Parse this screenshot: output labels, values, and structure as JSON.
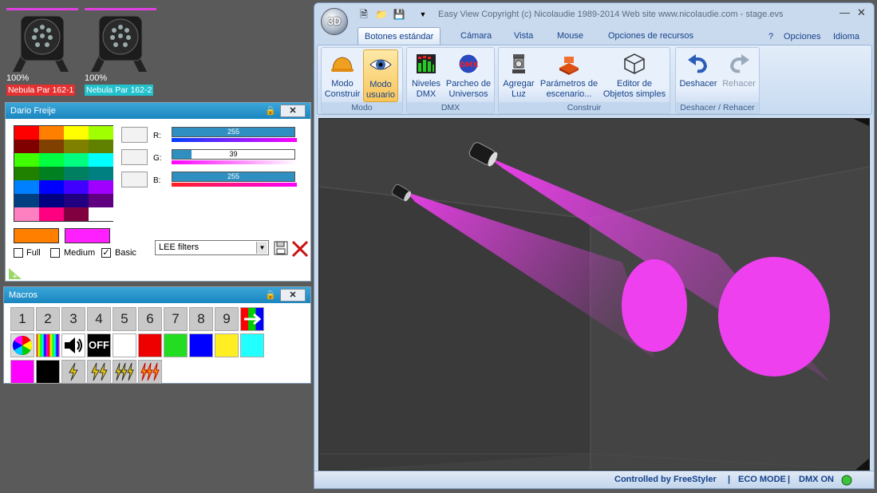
{
  "fixtures": [
    {
      "percent": "100%",
      "name": "Nebula Par 162-1",
      "label_color": "#e53030"
    },
    {
      "percent": "100%",
      "name": "Nebula Par 162-2",
      "label_color": "#22c2cc"
    }
  ],
  "color_panel": {
    "title": "Dario Freije",
    "swatches": [
      "#ff0000",
      "#ff8000",
      "#ffff00",
      "#a0ff00",
      "#800000",
      "#804000",
      "#808000",
      "#608000",
      "#40ff00",
      "#00ff40",
      "#00ff80",
      "#00ffff",
      "#208000",
      "#008020",
      "#008060",
      "#008080",
      "#0080ff",
      "#0000ff",
      "#4000ff",
      "#a000ff",
      "#004080",
      "#000080",
      "#200080",
      "#600080",
      "#ff80c0",
      "#ff0080",
      "#800040",
      "#ffffff"
    ],
    "current_color": "#ff8000",
    "previous_color": "#ff20ff",
    "r": {
      "label": "R:",
      "value": "255"
    },
    "g": {
      "label": "G:",
      "value": "39"
    },
    "b": {
      "label": "B:",
      "value": "255"
    },
    "opt_full": "Full",
    "opt_medium": "Medium",
    "opt_basic": "Basic",
    "filter_select": "LEE filters"
  },
  "macros": {
    "title": "Macros",
    "numbers": [
      "1",
      "2",
      "3",
      "4",
      "5",
      "6",
      "7",
      "8",
      "9"
    ],
    "off_label": "OFF",
    "color_buttons": [
      "#ffffff",
      "#ee0000",
      "#22dd22",
      "#0000ff",
      "#ffee22",
      "#22ffff",
      "#ff00ff",
      "#000000"
    ]
  },
  "app": {
    "logo": "3D",
    "title": "Easy View   Copyright (c) Nicolaudie 1989-2014   Web site www.nicolaudie.com - stage.evs",
    "tabs": [
      "Botones estándar",
      "Cámara",
      "Vista",
      "Mouse",
      "Opciones de recursos"
    ],
    "help": "?",
    "options": "Opciones",
    "language": "Idioma",
    "groups": {
      "modo": "Modo",
      "dmx": "DMX",
      "construir": "Construir",
      "undo": "Deshacer / Rehacer"
    },
    "buttons": {
      "modo_construir": "Modo\nConstruir",
      "modo_usuario": "Modo\nusuario",
      "niveles_dmx": "Niveles\nDMX",
      "parcheo": "Parcheo de\nUniversos",
      "agregar_luz": "Agregar\nLuz",
      "parametros": "Parámetros de\nescenario...",
      "editor": "Editor de\nObjetos simples",
      "deshacer": "Deshacer",
      "rehacer": "Rehacer"
    },
    "status": {
      "controlled": "Controlled by FreeStyler",
      "eco": "ECO MODE",
      "dmx": "DMX ON"
    }
  }
}
